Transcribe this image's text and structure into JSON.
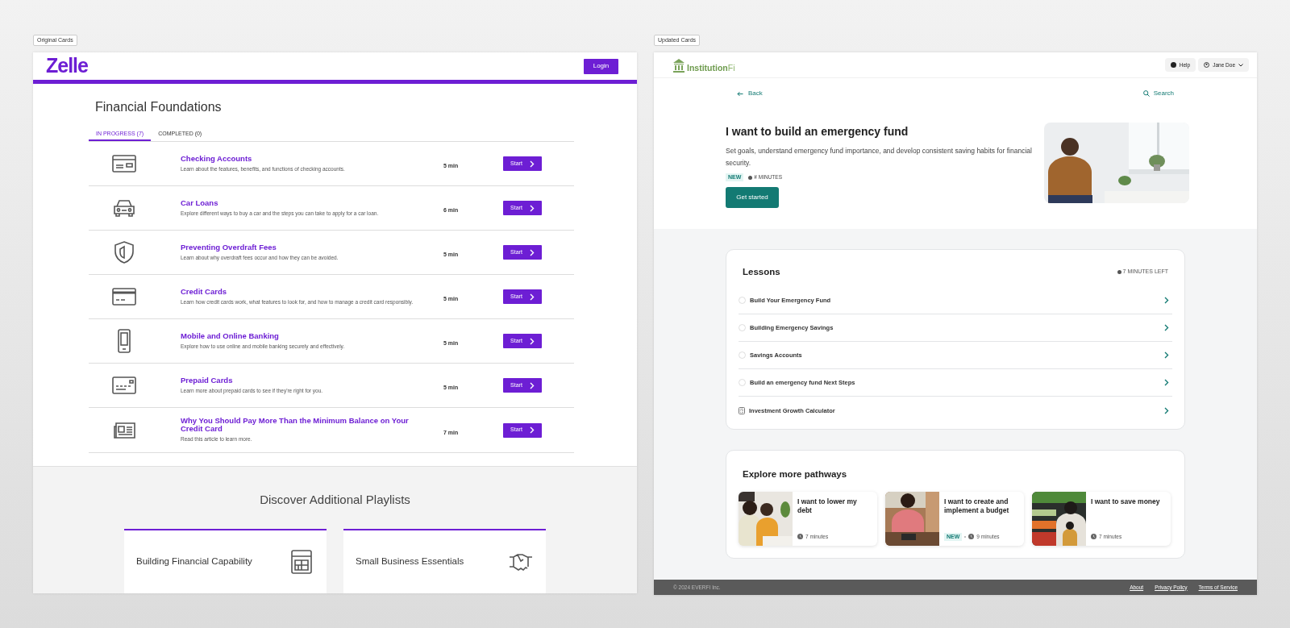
{
  "left_panel": {
    "label": "Original Cards",
    "logo": "Zelle",
    "login_button": "Login",
    "title": "Financial Foundations",
    "tabs": [
      {
        "label": "IN PROGRESS (7)",
        "selected": true
      },
      {
        "label": "COMPLETED (0)",
        "selected": false
      }
    ],
    "courses": [
      {
        "title": "Checking Accounts",
        "description": "Learn about the features, benefits, and functions of checking accounts.",
        "duration": "5 min",
        "button": "Start"
      },
      {
        "title": "Car Loans",
        "description": "Explore different ways to buy a car and the steps you can take to apply for a car loan.",
        "duration": "6 min",
        "button": "Start"
      },
      {
        "title": "Preventing Overdraft Fees",
        "description": "Learn about why overdraft fees occur and how they can be avoided.",
        "duration": "5 min",
        "button": "Start"
      },
      {
        "title": "Credit Cards",
        "description": "Learn how credit cards work, what features to look for, and how to manage a credit card responsibly.",
        "duration": "5 min",
        "button": "Start"
      },
      {
        "title": "Mobile and Online Banking",
        "description": "Explore how to use online and mobile banking securely and effectively.",
        "duration": "5 min",
        "button": "Start"
      },
      {
        "title": "Prepaid Cards",
        "description": "Learn more about prepaid cards to see if they're right for you.",
        "duration": "5 min",
        "button": "Start"
      },
      {
        "title": "Why You Should Pay More Than the Minimum Balance on Your Credit Card",
        "description": "Read this article to learn more.",
        "duration": "7 min",
        "button": "Start"
      }
    ],
    "discover": {
      "title": "Discover Additional Playlists",
      "playlists": [
        {
          "title": "Building Financial Capability"
        },
        {
          "title": "Small Business Essentials"
        }
      ]
    }
  },
  "right_panel": {
    "label": "Updated Cards",
    "logo": {
      "primary": "Institution",
      "secondary": "Fi"
    },
    "help_button": "Help",
    "user_menu": "Jane Doe",
    "back_link": "Back",
    "search_link": "Search",
    "hero": {
      "title": "I want to build an emergency fund",
      "description": "Set goals, understand emergency fund importance, and develop consistent saving habits for financial security.",
      "badge": "NEW",
      "duration": "# MINUTES",
      "button": "Get started"
    },
    "lessons": {
      "title": "Lessons",
      "time_left": "7 MINUTES LEFT",
      "items": [
        {
          "kind": "lesson",
          "title": "Build Your Emergency Fund",
          "completed": false
        },
        {
          "kind": "lesson",
          "title": "Building Emergency Savings",
          "completed": false
        },
        {
          "kind": "lesson",
          "title": "Savings Accounts",
          "completed": false
        },
        {
          "kind": "lesson",
          "title": "Build an emergency fund Next Steps",
          "completed": false
        },
        {
          "kind": "calculator",
          "title": "Investment Growth Calculator"
        }
      ]
    },
    "pathways": {
      "title": "Explore more pathways",
      "cards": [
        {
          "title": "I want to lower my debt",
          "duration": "7 minutes"
        },
        {
          "title": "I want to create and implement a budget",
          "badge": "NEW",
          "duration": "9 minutes"
        },
        {
          "title": "I want to save money",
          "duration": "7 minutes"
        }
      ]
    },
    "footer": {
      "copyright": "© 2024 EVERFI Inc.",
      "links": [
        "About",
        "Privacy Policy",
        "Terms of Service"
      ]
    }
  }
}
